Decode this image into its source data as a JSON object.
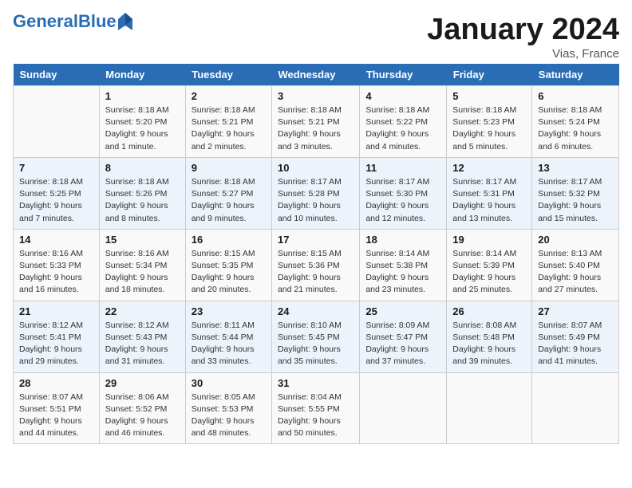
{
  "header": {
    "logo_general": "General",
    "logo_blue": "Blue",
    "month_title": "January 2024",
    "location": "Vias, France"
  },
  "days_of_week": [
    "Sunday",
    "Monday",
    "Tuesday",
    "Wednesday",
    "Thursday",
    "Friday",
    "Saturday"
  ],
  "weeks": [
    [
      {
        "day": "",
        "sunrise": "",
        "sunset": "",
        "daylight": ""
      },
      {
        "day": "1",
        "sunrise": "Sunrise: 8:18 AM",
        "sunset": "Sunset: 5:20 PM",
        "daylight": "Daylight: 9 hours and 1 minute."
      },
      {
        "day": "2",
        "sunrise": "Sunrise: 8:18 AM",
        "sunset": "Sunset: 5:21 PM",
        "daylight": "Daylight: 9 hours and 2 minutes."
      },
      {
        "day": "3",
        "sunrise": "Sunrise: 8:18 AM",
        "sunset": "Sunset: 5:21 PM",
        "daylight": "Daylight: 9 hours and 3 minutes."
      },
      {
        "day": "4",
        "sunrise": "Sunrise: 8:18 AM",
        "sunset": "Sunset: 5:22 PM",
        "daylight": "Daylight: 9 hours and 4 minutes."
      },
      {
        "day": "5",
        "sunrise": "Sunrise: 8:18 AM",
        "sunset": "Sunset: 5:23 PM",
        "daylight": "Daylight: 9 hours and 5 minutes."
      },
      {
        "day": "6",
        "sunrise": "Sunrise: 8:18 AM",
        "sunset": "Sunset: 5:24 PM",
        "daylight": "Daylight: 9 hours and 6 minutes."
      }
    ],
    [
      {
        "day": "7",
        "sunrise": "Sunrise: 8:18 AM",
        "sunset": "Sunset: 5:25 PM",
        "daylight": "Daylight: 9 hours and 7 minutes."
      },
      {
        "day": "8",
        "sunrise": "Sunrise: 8:18 AM",
        "sunset": "Sunset: 5:26 PM",
        "daylight": "Daylight: 9 hours and 8 minutes."
      },
      {
        "day": "9",
        "sunrise": "Sunrise: 8:18 AM",
        "sunset": "Sunset: 5:27 PM",
        "daylight": "Daylight: 9 hours and 9 minutes."
      },
      {
        "day": "10",
        "sunrise": "Sunrise: 8:17 AM",
        "sunset": "Sunset: 5:28 PM",
        "daylight": "Daylight: 9 hours and 10 minutes."
      },
      {
        "day": "11",
        "sunrise": "Sunrise: 8:17 AM",
        "sunset": "Sunset: 5:30 PM",
        "daylight": "Daylight: 9 hours and 12 minutes."
      },
      {
        "day": "12",
        "sunrise": "Sunrise: 8:17 AM",
        "sunset": "Sunset: 5:31 PM",
        "daylight": "Daylight: 9 hours and 13 minutes."
      },
      {
        "day": "13",
        "sunrise": "Sunrise: 8:17 AM",
        "sunset": "Sunset: 5:32 PM",
        "daylight": "Daylight: 9 hours and 15 minutes."
      }
    ],
    [
      {
        "day": "14",
        "sunrise": "Sunrise: 8:16 AM",
        "sunset": "Sunset: 5:33 PM",
        "daylight": "Daylight: 9 hours and 16 minutes."
      },
      {
        "day": "15",
        "sunrise": "Sunrise: 8:16 AM",
        "sunset": "Sunset: 5:34 PM",
        "daylight": "Daylight: 9 hours and 18 minutes."
      },
      {
        "day": "16",
        "sunrise": "Sunrise: 8:15 AM",
        "sunset": "Sunset: 5:35 PM",
        "daylight": "Daylight: 9 hours and 20 minutes."
      },
      {
        "day": "17",
        "sunrise": "Sunrise: 8:15 AM",
        "sunset": "Sunset: 5:36 PM",
        "daylight": "Daylight: 9 hours and 21 minutes."
      },
      {
        "day": "18",
        "sunrise": "Sunrise: 8:14 AM",
        "sunset": "Sunset: 5:38 PM",
        "daylight": "Daylight: 9 hours and 23 minutes."
      },
      {
        "day": "19",
        "sunrise": "Sunrise: 8:14 AM",
        "sunset": "Sunset: 5:39 PM",
        "daylight": "Daylight: 9 hours and 25 minutes."
      },
      {
        "day": "20",
        "sunrise": "Sunrise: 8:13 AM",
        "sunset": "Sunset: 5:40 PM",
        "daylight": "Daylight: 9 hours and 27 minutes."
      }
    ],
    [
      {
        "day": "21",
        "sunrise": "Sunrise: 8:12 AM",
        "sunset": "Sunset: 5:41 PM",
        "daylight": "Daylight: 9 hours and 29 minutes."
      },
      {
        "day": "22",
        "sunrise": "Sunrise: 8:12 AM",
        "sunset": "Sunset: 5:43 PM",
        "daylight": "Daylight: 9 hours and 31 minutes."
      },
      {
        "day": "23",
        "sunrise": "Sunrise: 8:11 AM",
        "sunset": "Sunset: 5:44 PM",
        "daylight": "Daylight: 9 hours and 33 minutes."
      },
      {
        "day": "24",
        "sunrise": "Sunrise: 8:10 AM",
        "sunset": "Sunset: 5:45 PM",
        "daylight": "Daylight: 9 hours and 35 minutes."
      },
      {
        "day": "25",
        "sunrise": "Sunrise: 8:09 AM",
        "sunset": "Sunset: 5:47 PM",
        "daylight": "Daylight: 9 hours and 37 minutes."
      },
      {
        "day": "26",
        "sunrise": "Sunrise: 8:08 AM",
        "sunset": "Sunset: 5:48 PM",
        "daylight": "Daylight: 9 hours and 39 minutes."
      },
      {
        "day": "27",
        "sunrise": "Sunrise: 8:07 AM",
        "sunset": "Sunset: 5:49 PM",
        "daylight": "Daylight: 9 hours and 41 minutes."
      }
    ],
    [
      {
        "day": "28",
        "sunrise": "Sunrise: 8:07 AM",
        "sunset": "Sunset: 5:51 PM",
        "daylight": "Daylight: 9 hours and 44 minutes."
      },
      {
        "day": "29",
        "sunrise": "Sunrise: 8:06 AM",
        "sunset": "Sunset: 5:52 PM",
        "daylight": "Daylight: 9 hours and 46 minutes."
      },
      {
        "day": "30",
        "sunrise": "Sunrise: 8:05 AM",
        "sunset": "Sunset: 5:53 PM",
        "daylight": "Daylight: 9 hours and 48 minutes."
      },
      {
        "day": "31",
        "sunrise": "Sunrise: 8:04 AM",
        "sunset": "Sunset: 5:55 PM",
        "daylight": "Daylight: 9 hours and 50 minutes."
      },
      {
        "day": "",
        "sunrise": "",
        "sunset": "",
        "daylight": ""
      },
      {
        "day": "",
        "sunrise": "",
        "sunset": "",
        "daylight": ""
      },
      {
        "day": "",
        "sunrise": "",
        "sunset": "",
        "daylight": ""
      }
    ]
  ]
}
